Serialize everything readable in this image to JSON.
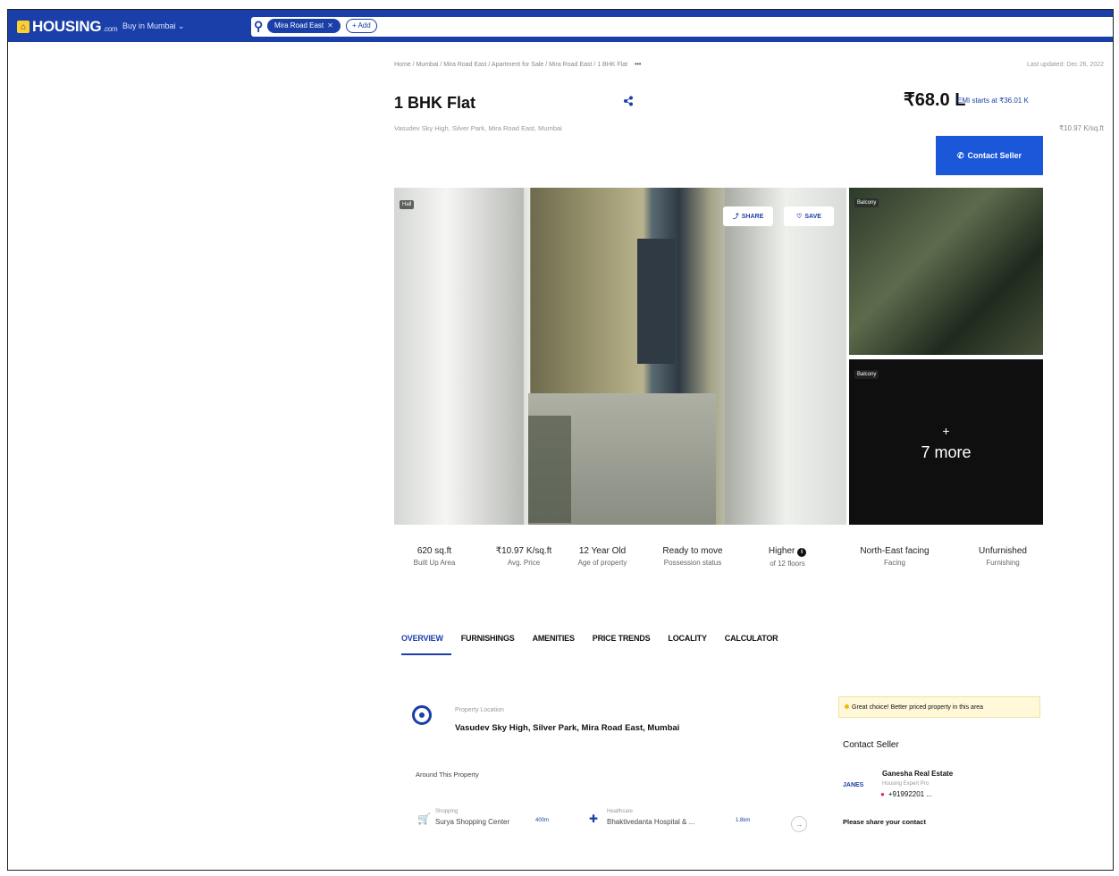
{
  "header": {
    "logo": "HOUSING",
    "logo_suffix": ".com",
    "city": "Buy in Mumbai ⌄",
    "search_chip": "Mira Road East",
    "add_label": "+ Add"
  },
  "breadcrumb": "Home / Mumbai / Mira Road East / Apartment for Sale / Mira Road East / 1 BHK Flat",
  "breadcrumb_more": "•••",
  "last_updated": "Last updated: Dec 26, 2022",
  "listing": {
    "title": "1 BHK Flat",
    "address_short": "Vasudev Sky High, Silver Park, Mira Road East, Mumbai",
    "price": "₹68.0 L",
    "emi": "EMI starts at ₹36.01 K",
    "price_per_sqft": "₹10.97 K/sq.ft",
    "contact_button": "Contact Seller"
  },
  "gallery": {
    "main_tag": "Hall",
    "share": "SHARE",
    "save": "SAVE",
    "thumb1_tag": "Balcony",
    "thumb2_tag": "Balcony",
    "more_plus": "+",
    "more_count": "7 more"
  },
  "facts": [
    {
      "value": "620 sq.ft",
      "label": "Built Up Area"
    },
    {
      "value": "₹10.97 K/sq.ft",
      "label": "Avg. Price"
    },
    {
      "value": "12 Year Old",
      "label": "Age of property"
    },
    {
      "value": "Ready to move",
      "label": "Possession status"
    },
    {
      "value": "Higher",
      "label": "of 12 floors"
    },
    {
      "value": "North-East facing",
      "label": "Facing"
    },
    {
      "value": "Unfurnished",
      "label": "Furnishing"
    }
  ],
  "tabs": [
    "OVERVIEW",
    "FURNISHINGS",
    "AMENITIES",
    "PRICE TRENDS",
    "LOCALITY",
    "CALCULATOR"
  ],
  "location": {
    "label": "Property Location",
    "address": "Vasudev Sky High, Silver Park, Mira Road East, Mumbai"
  },
  "around": {
    "title": "Around This Property",
    "items": [
      {
        "category": "Shopping",
        "name": "Surya Shopping Center",
        "distance": "400m"
      },
      {
        "category": "Healthcare",
        "name": "Bhaktivedanta Hospital & ...",
        "distance": "1.8km"
      }
    ]
  },
  "great_choice": "Great choice! Better priced property in this area",
  "contact": {
    "title": "Contact Seller",
    "agent_logo": "JANES",
    "agent_name": "Ganesha Real Estate",
    "agent_sub": "Housing Expert Pro",
    "phone": "+91992201 ...",
    "share_contact": "Please share your contact"
  },
  "colors": {
    "brand": "#1b3fa8",
    "button": "#1b57d9",
    "highlight": "#fff8d9"
  }
}
